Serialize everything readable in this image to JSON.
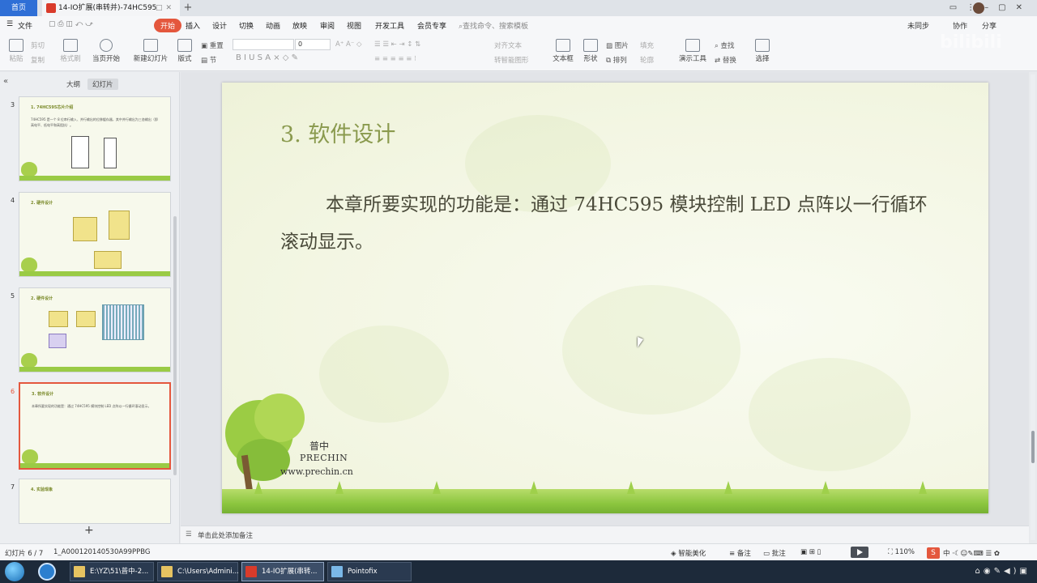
{
  "titlebar": {
    "home_tab": "首页",
    "doc_tab": "14-IO扩展(串转并)-74HC595"
  },
  "menubar": {
    "file": "文件",
    "start": "开始",
    "items": [
      "插入",
      "设计",
      "切换",
      "动画",
      "放映",
      "审阅",
      "视图",
      "开发工具",
      "会员专享"
    ],
    "search": "查找命令、搜索模板",
    "sync": "未同步",
    "collab": "协作",
    "share": "分享"
  },
  "ribbon": {
    "paste": "粘贴",
    "cut": "剪切",
    "copy": "复制",
    "format_painter": "格式刷",
    "from_start": "当页开始",
    "new_slide": "新建幻灯片",
    "layout": "版式",
    "section": "节",
    "reset": "重置",
    "font_size": "0",
    "align_text": "对齐文本",
    "smart_graphic": "转智能图形",
    "textbox": "文本框",
    "shape": "形状",
    "picture": "图片",
    "fill": "填充",
    "arrange": "排列",
    "outline": "轮廓",
    "present_tools": "演示工具",
    "find": "查找",
    "replace": "替换",
    "select": "选择",
    "watermark": "bilibili"
  },
  "leftpanel": {
    "tab_outline": "大纲",
    "tab_slides": "幻灯片",
    "thumbnails": [
      {
        "num": "3",
        "title": "1. 74HC595芯片介绍",
        "text": "74HC595 是一个 8 位串行输入、并行输出的位移缓存器，其中并行输出为三态输出（即高电平、低电平和高阻抗）。"
      },
      {
        "num": "4",
        "title": "2. 硬件设计",
        "text": ""
      },
      {
        "num": "5",
        "title": "2. 硬件设计",
        "text": ""
      },
      {
        "num": "6",
        "title": "3. 软件设计",
        "text": "本章所要实现的功能是：通过 74HC595 模块控制 LED 点阵以一行循环滚动显示。"
      },
      {
        "num": "7",
        "title": "4. 实验现象",
        "text": ""
      }
    ]
  },
  "slide": {
    "title": "3. 软件设计",
    "body": "本章所要实现的功能是：通过 74HC595 模块控制 LED 点阵以一行循环滚动显示。",
    "brand_cn": "普中",
    "brand_en": "PRECHIN",
    "brand_url": "www.prechin.cn"
  },
  "notes": {
    "placeholder": "单击此处添加备注"
  },
  "status": {
    "slide_counter": "幻灯片 6 / 7",
    "doc_id": "1_A000120140530A99PPBG",
    "smart_beautify": "智能美化",
    "notes_btn": "备注",
    "comments_btn": "批注",
    "zoom": "110%",
    "ime": "S",
    "ime_lang": "中"
  },
  "taskbar": {
    "tasks": [
      "E:\\YZ\\51\\普中-2...",
      "C:\\Users\\Admini...",
      "14-IO扩展(串转...",
      "Pointofix"
    ]
  },
  "colors": {
    "accent": "#e4573d",
    "title_bar_home": "#2f6fd6",
    "slide_title": "#8a9a4e",
    "grass": "#8cc63f"
  }
}
